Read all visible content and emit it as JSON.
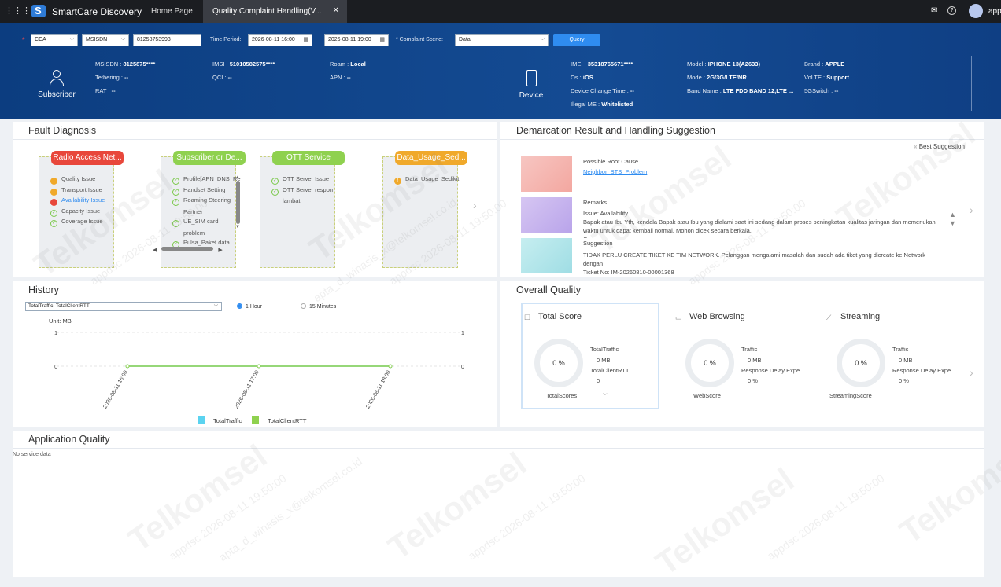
{
  "topbar": {
    "app_name": "SmartCare Discovery",
    "tab_home": "Home Page",
    "tab_active": "Quality Complaint Handling(V...",
    "tab_close": "✕",
    "user": "appd"
  },
  "query": {
    "service_type": "CCA",
    "id_type": "MSISDN",
    "msisdn": "81258753993",
    "time_period_label": "Time Period:",
    "start": "2026-08-11 16:00",
    "end": "2026-08-11 19:00",
    "scene_label": "* Complaint Scene:",
    "scene": "Data",
    "query_btn": "Query",
    "req": "*"
  },
  "subscriber": {
    "label": "Subscriber",
    "fields": [
      {
        "k": "MSISDN :",
        "v": "8125875****"
      },
      {
        "k": "Tethering :",
        "v": "--"
      },
      {
        "k": "RAT :",
        "v": "--"
      },
      {
        "k": "IMSI :",
        "v": "51010582575****"
      },
      {
        "k": "QCI :",
        "v": "--"
      },
      {
        "k": "Roam :",
        "v": "Local"
      },
      {
        "k": "APN :",
        "v": "--"
      }
    ]
  },
  "device": {
    "label": "Device",
    "fields": [
      {
        "k": "IMEI :",
        "v": "35318765671****"
      },
      {
        "k": "Os :",
        "v": "iOS"
      },
      {
        "k": "Device Change Time :",
        "v": "--"
      },
      {
        "k": "Illegal ME :",
        "v": "Whitelisted"
      },
      {
        "k": "Model :",
        "v": "IPHONE 13(A2633)"
      },
      {
        "k": "Mode :",
        "v": "2G/3G/LTE/NR"
      },
      {
        "k": "Band Name :",
        "v": "LTE FDD BAND 12,LTE ..."
      },
      {
        "k": "Brand :",
        "v": "APPLE"
      },
      {
        "k": "VoLTE :",
        "v": "Support"
      },
      {
        "k": "5GSwitch :",
        "v": "--"
      }
    ]
  },
  "fault": {
    "title": "Fault Diagnosis",
    "cards": [
      {
        "title": "Radio Access Net...",
        "color": "#e8473b",
        "items": [
          {
            "text": "Quality Issue",
            "st": "warn"
          },
          {
            "text": "Transport Issue",
            "st": "warn"
          },
          {
            "text": "Availability Issue",
            "st": "err"
          },
          {
            "text": "Capacity Issue",
            "st": "ok"
          },
          {
            "text": "Coverage Issue",
            "st": "ok"
          }
        ]
      },
      {
        "title": "Subscriber or De...",
        "color": "#8fd14f",
        "items": [
          {
            "text": "Profile[APN_DNS_Re",
            "st": "ok"
          },
          {
            "text": "Handset Setting",
            "st": "ok"
          },
          {
            "text": "Roaming Steering",
            "st": "ok"
          },
          {
            "text": "Partner",
            "st": "none"
          },
          {
            "text": "UE_SIM card",
            "st": "ok"
          },
          {
            "text": "problem",
            "st": "none"
          },
          {
            "text": "Pulsa_Paket data",
            "st": "ok"
          }
        ]
      },
      {
        "title": "OTT Service",
        "color": "#8fd14f",
        "items": [
          {
            "text": "OTT Server Issue",
            "st": "ok"
          },
          {
            "text": "OTT Server respon",
            "st": "ok"
          },
          {
            "text": "lambat",
            "st": "none"
          }
        ]
      },
      {
        "title": "Data_Usage_Sed...",
        "color": "#f0a92b",
        "items": [
          {
            "text": "Data_Usage_Sedikit",
            "st": "warn"
          }
        ]
      }
    ]
  },
  "demarcation": {
    "title": "Demarcation Result and Handling Suggestion",
    "best": "Best Suggestion",
    "root_label": "Possible Root Cause",
    "root_value": "Neighbor_BTS_Problem",
    "remarks_label": "Remarks",
    "remarks_text": "Issue: Availability\nBapak atau Ibu Yth, kendala Bapak atau Ibu yang dialami saat ini sedang dalam proses peningkatan kualitas jaringan dan memerlukan waktu untuk dapat kembali normal. Mohon dicek secara berkala.\nCause : --",
    "sugg_label": "Suggestion",
    "sugg_text": "TIDAK PERLU CREATE TIKET KE TIM NETWORK. Pelanggan mengalami masalah dan sudah ada tiket yang dicreate ke Network dengan\nTicket No: IM-20260810-00001368"
  },
  "history": {
    "title": "History",
    "metric_select": "TotalTraffic, TotalClientRTT",
    "opt1": "1 Hour",
    "opt2": "15 Minutes",
    "unit": "Unit: MB"
  },
  "chart_data": {
    "type": "line",
    "x": [
      "2026-08-11 16:00",
      "2026-08-11 17:00",
      "2026-08-11 18:00"
    ],
    "series": [
      {
        "name": "TotalTraffic",
        "values": [
          0,
          0,
          0
        ],
        "color": "#5bd3f0"
      },
      {
        "name": "TotalClientRTT",
        "values": [
          0,
          0,
          0
        ],
        "color": "#8fd14f"
      }
    ],
    "ylim": [
      0,
      1
    ],
    "yticks": [
      0,
      1
    ],
    "grid": true,
    "legend": "bottom"
  },
  "overall": {
    "title": "Overall Quality",
    "cards": [
      {
        "title": "Total Score",
        "score": "0 %",
        "caption": "TotalScores",
        "l1": "TotalTraffic",
        "v1": "0 MB",
        "l2": "TotalClientRTT",
        "v2": "0"
      },
      {
        "title": "Web Browsing",
        "score": "0 %",
        "caption": "WebScore",
        "l1": "Traffic",
        "v1": "0 MB",
        "l2": "Response Delay Expe...",
        "v2": "0 %"
      },
      {
        "title": "Streaming",
        "score": "0 %",
        "caption": "StreamingScore",
        "l1": "Traffic",
        "v1": "0 MB",
        "l2": "Response Delay Expe...",
        "v2": "0 %"
      }
    ]
  },
  "appq": {
    "title": "Application Quality",
    "empty": "No service data"
  },
  "watermark": {
    "brand": "Telkomsel",
    "stamp": "appdsc 2026-08-11 19:50:00",
    "email": "apta_d_winasis_x@telkomsel.co.id"
  }
}
